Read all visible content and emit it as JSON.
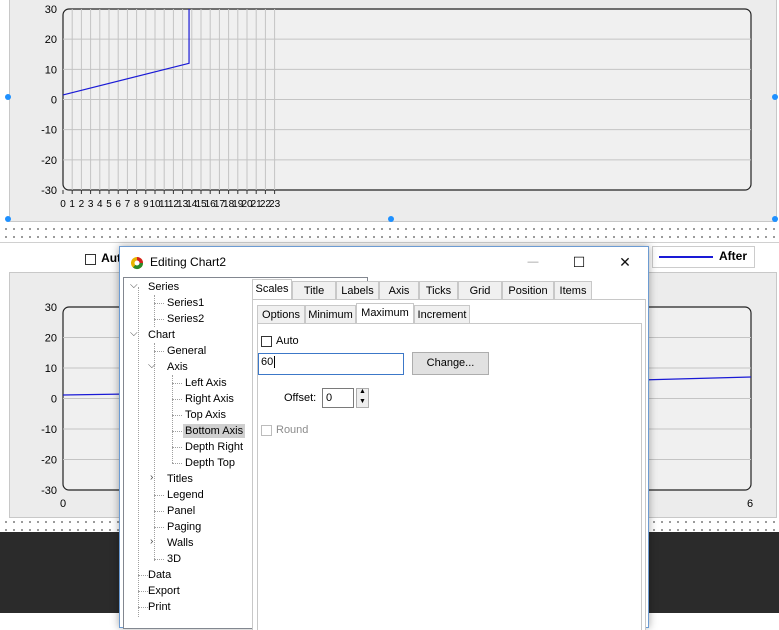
{
  "top_chart": {
    "y_ticks": [
      "30",
      "20",
      "10",
      "0",
      "-10",
      "-20",
      "-30"
    ],
    "x_ticks": [
      "0",
      "1",
      "2",
      "3",
      "4",
      "5",
      "6",
      "7",
      "8",
      "9",
      "10",
      "11",
      "12",
      "13",
      "14",
      "15",
      "16",
      "17",
      "18",
      "19",
      "20",
      "21",
      "22",
      "23"
    ],
    "line_color": "#1a1ad6"
  },
  "legend": {
    "left_label": "Aut",
    "right_label": "After"
  },
  "bottom_chart": {
    "y_ticks": [
      "30",
      "20",
      "10",
      "0",
      "-10",
      "-20",
      "-30"
    ],
    "x_left_tick": "0",
    "x_right_tick": "6"
  },
  "dialog": {
    "title": "Editing Chart2",
    "minimize": "—",
    "maximize": "☐",
    "close": "✕",
    "tree": {
      "series": "Series",
      "series1": "Series1",
      "series2": "Series2",
      "chart": "Chart",
      "general": "General",
      "axis": "Axis",
      "left_axis": "Left Axis",
      "right_axis": "Right Axis",
      "top_axis": "Top Axis",
      "bottom_axis": "Bottom Axis",
      "depth_right": "Depth Right",
      "depth_top": "Depth Top",
      "titles": "Titles",
      "legend": "Legend",
      "panel": "Panel",
      "paging": "Paging",
      "walls": "Walls",
      "three_d": "3D",
      "data": "Data",
      "export": "Export",
      "print": "Print"
    },
    "tabs": [
      "Scales",
      "Title",
      "Labels",
      "Axis",
      "Ticks",
      "Grid",
      "Position",
      "Items"
    ],
    "subtabs": [
      "Options",
      "Minimum",
      "Maximum",
      "Increment"
    ],
    "auto_label": "Auto",
    "maximum_value": "60",
    "change_button": "Change...",
    "offset_label": "Offset:",
    "offset_value": "0",
    "round_label": "Round"
  }
}
